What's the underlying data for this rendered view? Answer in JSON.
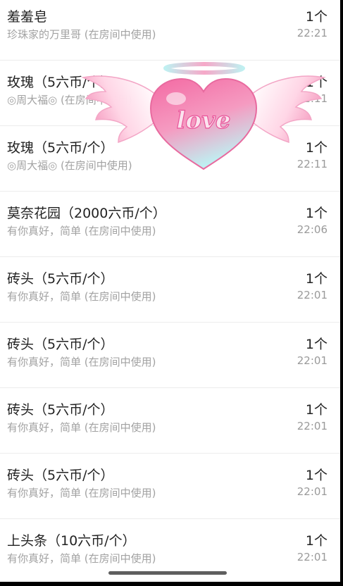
{
  "gift_records": [
    {
      "title": "羞羞皂",
      "subtitle": "珍珠家的万里哥 (在房间中使用)",
      "quantity": "1个",
      "time": "22:21"
    },
    {
      "title": "玫瑰（5六币/个）",
      "subtitle": "◎周大福◎ (在房间中使用)",
      "quantity": "1个",
      "time": "22:11"
    },
    {
      "title": "玫瑰（5六币/个）",
      "subtitle": "◎周大福◎ (在房间中使用)",
      "quantity": "1个",
      "time": "22:11"
    },
    {
      "title": "莫奈花园（2000六币/个）",
      "subtitle": "有你真好，简单 (在房间中使用)",
      "quantity": "1个",
      "time": "22:06"
    },
    {
      "title": "砖头（5六币/个）",
      "subtitle": "有你真好，简单 (在房间中使用)",
      "quantity": "1个",
      "time": "22:01"
    },
    {
      "title": "砖头（5六币/个）",
      "subtitle": "有你真好，简单 (在房间中使用)",
      "quantity": "1个",
      "time": "22:01"
    },
    {
      "title": "砖头（5六币/个）",
      "subtitle": "有你真好，简单 (在房间中使用)",
      "quantity": "1个",
      "time": "22:01"
    },
    {
      "title": "砖头（5六币/个）",
      "subtitle": "有你真好，简单 (在房间中使用)",
      "quantity": "1个",
      "time": "22:01"
    },
    {
      "title": "上头条（10六币/个）",
      "subtitle": "有你真好，简单 (在房间中使用)",
      "quantity": "1个",
      "time": "22:01"
    }
  ],
  "gift_effect": {
    "text": "love",
    "heart_color": "#f27fb0",
    "wing_color": "#ffd3e3",
    "halo_color": "#c9f1f2"
  }
}
